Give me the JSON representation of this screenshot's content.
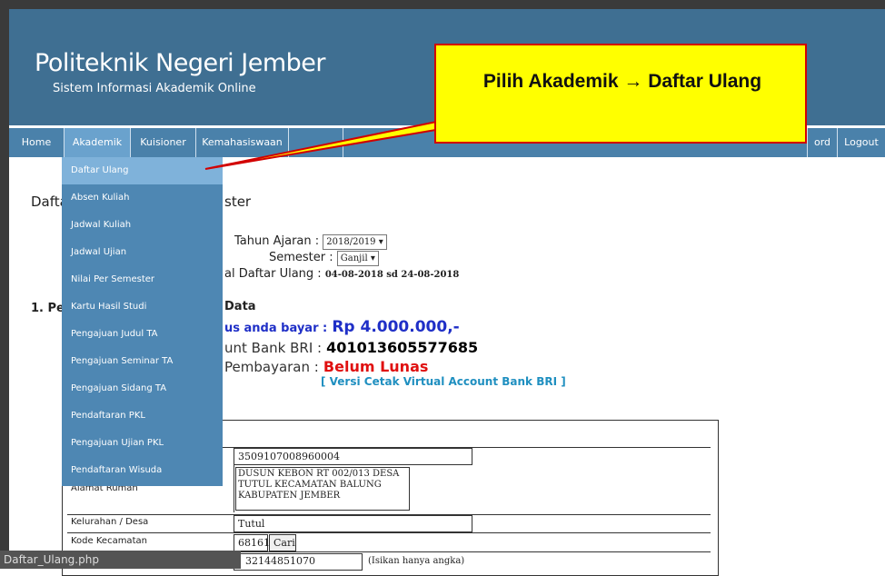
{
  "header": {
    "title": "Politeknik Negeri Jember",
    "subtitle": "Sistem Informasi Akademik Online"
  },
  "nav": {
    "home": "Home",
    "akademik": "Akademik",
    "kuisioner": "Kuisioner",
    "kemahasiswaan": "Kemahasiswaan",
    "password": "ord",
    "logout": "Logout"
  },
  "dropdown": {
    "items": [
      "Daftar Ulang",
      "Absen Kuliah",
      "Jadwal Kuliah",
      "Jadwal Ujian",
      "Nilai Per Semester",
      "Kartu Hasil Studi",
      "Pengajuan Judul TA",
      "Pengajuan Seminar TA",
      "Pengajuan Sidang TA",
      "Pendaftaran PKL",
      "Pengajuan Ujian PKL",
      "Pendaftaran Wisuda"
    ]
  },
  "callout": {
    "text": "Pilih Akademik → Daftar Ulang",
    "bg": "#ffff00",
    "border": "#d20000"
  },
  "page": {
    "heading_left": "Dafta",
    "heading_right": "ster",
    "tahun_label": "Tahun Ajaran :",
    "tahun_value": "2018/2019",
    "semester_label": "Semester :",
    "semester_value": "Ganjil",
    "jadwal_label": "al Daftar Ulang :",
    "jadwal_value": "04-08-2018 sd 24-08-2018",
    "section_left": "1. Pe",
    "section_right": "Data",
    "bayar_label": "us anda bayar :",
    "bayar_value": "Rp  4.000.000,-",
    "account_label": "unt Bank BRI :",
    "account_value": "401013605577685",
    "status_label": "Pembayaran :",
    "status_value": "Belum Lunas",
    "print_link": "[ Versi Cetak Virtual Account Bank BRI ]"
  },
  "form": {
    "nik_value": "3509107008960004",
    "alamat_label": "Alamat Rumah",
    "alamat_value": "DUSUN KEBON RT 002/013 DESA TUTUL KECAMATAN BALUNG KABUPATEN JEMBER",
    "kelurahan_label": "Kelurahan / Desa",
    "kelurahan_value": "Tutul",
    "kode_label": "Kode Kecamatan",
    "kode_value": "68161",
    "cari_label": "Cari",
    "phone_value": "32144851070",
    "phone_hint": "(Isikan hanya angka)"
  },
  "status": {
    "url": "Daftar_Ulang.php"
  }
}
